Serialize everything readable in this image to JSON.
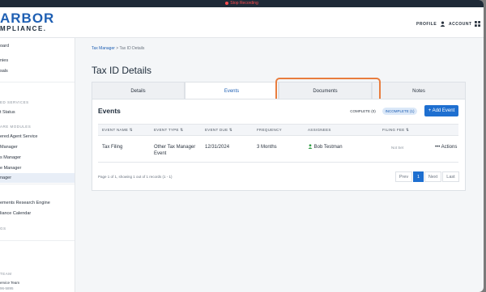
{
  "recording_bar": {
    "label": "Stop Recording"
  },
  "header": {
    "logo_line1": "ARBOR",
    "logo_line2": "MPLIANCE.",
    "profile_label": "PROFILE",
    "account_label": "ACCOUNT"
  },
  "sidebar": {
    "items": [
      {
        "label": "oard"
      },
      {
        "label": "nies"
      },
      {
        "label": "sals"
      },
      {
        "label": "ED SERVICES"
      },
      {
        "label": "t Status"
      },
      {
        "label": "ARE MODULES"
      },
      {
        "label": "ered Agent Service"
      },
      {
        "label": "Manager"
      },
      {
        "label": "s Manager"
      },
      {
        "label": "e Manager"
      },
      {
        "label": "nager"
      },
      {
        "label": "ements Research Engine"
      },
      {
        "label": "liance Calendar"
      },
      {
        "label": "GS"
      },
      {
        "label": "TEAM"
      },
      {
        "label": "ervice Team"
      },
      {
        "label": "96-5895"
      }
    ]
  },
  "breadcrumb": {
    "parent": "Tax Manager",
    "separator": ">",
    "current": "Tax ID Details"
  },
  "page_title": "Tax ID Details",
  "tabs": [
    {
      "label": "Details"
    },
    {
      "label": "Events"
    },
    {
      "label": "Documents"
    },
    {
      "label": "Notes"
    }
  ],
  "events": {
    "title": "Events",
    "complete_pill": "COMPLETE (0)",
    "incomplete_pill": "INCOMPLETE (1)",
    "add_button": "+ Add Event",
    "columns": [
      "EVENT NAME ⇅",
      "EVENT TYPE ⇅",
      "EVENT DUE ⇅",
      "FREQUENCY",
      "ASSIGNEES",
      "FILING FEE ⇅"
    ],
    "rows": [
      {
        "name": "Tax Filing",
        "type": "Other Tax Manager Event",
        "due": "12/31/2024",
        "frequency": "3 Months",
        "assignee": "Bob Testman",
        "fee": "Not Set",
        "actions": "••• Actions"
      }
    ],
    "pager_info": "Page 1 of 1, showing 1 out of 1 records (1 - 1)",
    "pager": {
      "prev": "Prev",
      "current": "1",
      "next": "Next",
      "last": "Last"
    }
  },
  "colors": {
    "accent": "#1e6fd0",
    "highlight": "#e87d3e",
    "record": "#ff4d4f"
  }
}
